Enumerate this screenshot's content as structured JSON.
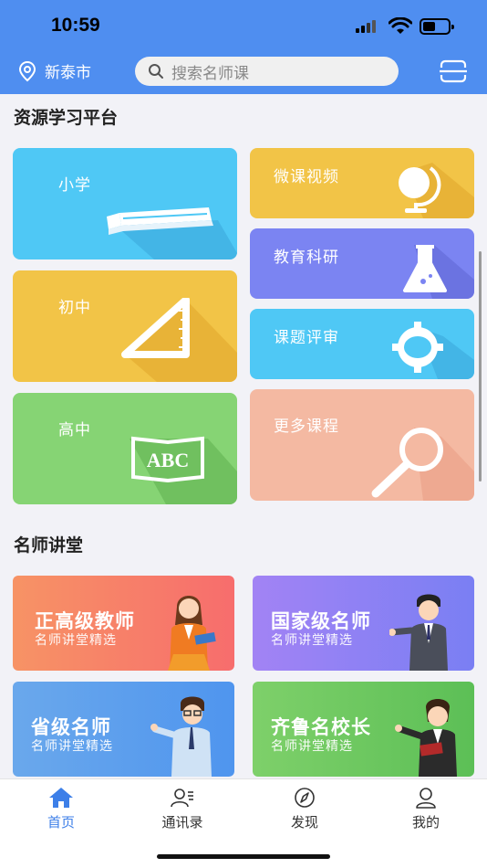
{
  "status": {
    "time": "10:59"
  },
  "header": {
    "location": "新泰市",
    "search_placeholder": "搜索名师课"
  },
  "sections": {
    "resource_title": "资源学习平台",
    "teacher_title": "名师讲堂"
  },
  "resource_cards": {
    "primary": {
      "label": "小学",
      "icon": "book-icon",
      "color": "#4fc8f5"
    },
    "junior": {
      "label": "初中",
      "icon": "set-square-icon",
      "color": "#f2c447"
    },
    "senior": {
      "label": "高中",
      "icon": "abc-board-icon",
      "color": "#86d474"
    },
    "micro_video": {
      "label": "微课视频",
      "icon": "globe-icon",
      "color": "#f2c447"
    },
    "research": {
      "label": "教育科研",
      "icon": "flask-icon",
      "color": "#7b84f2"
    },
    "review": {
      "label": "课题评审",
      "icon": "gear-icon",
      "color": "#4fc8f5"
    },
    "more": {
      "label": "更多课程",
      "icon": "magnifier-icon",
      "color": "#f4b9a2"
    }
  },
  "teacher_cards": [
    {
      "title": "正高级教师",
      "subtitle": "名师讲堂精选"
    },
    {
      "title": "国家级名师",
      "subtitle": "名师讲堂精选"
    },
    {
      "title": "省级名师",
      "subtitle": "名师讲堂精选"
    },
    {
      "title": "齐鲁名校长",
      "subtitle": "名师讲堂精选"
    }
  ],
  "tabs": [
    {
      "label": "首页",
      "icon": "home-icon",
      "active": true
    },
    {
      "label": "通讯录",
      "icon": "contacts-icon"
    },
    {
      "label": "发现",
      "icon": "compass-icon"
    },
    {
      "label": "我的",
      "icon": "user-icon"
    }
  ]
}
